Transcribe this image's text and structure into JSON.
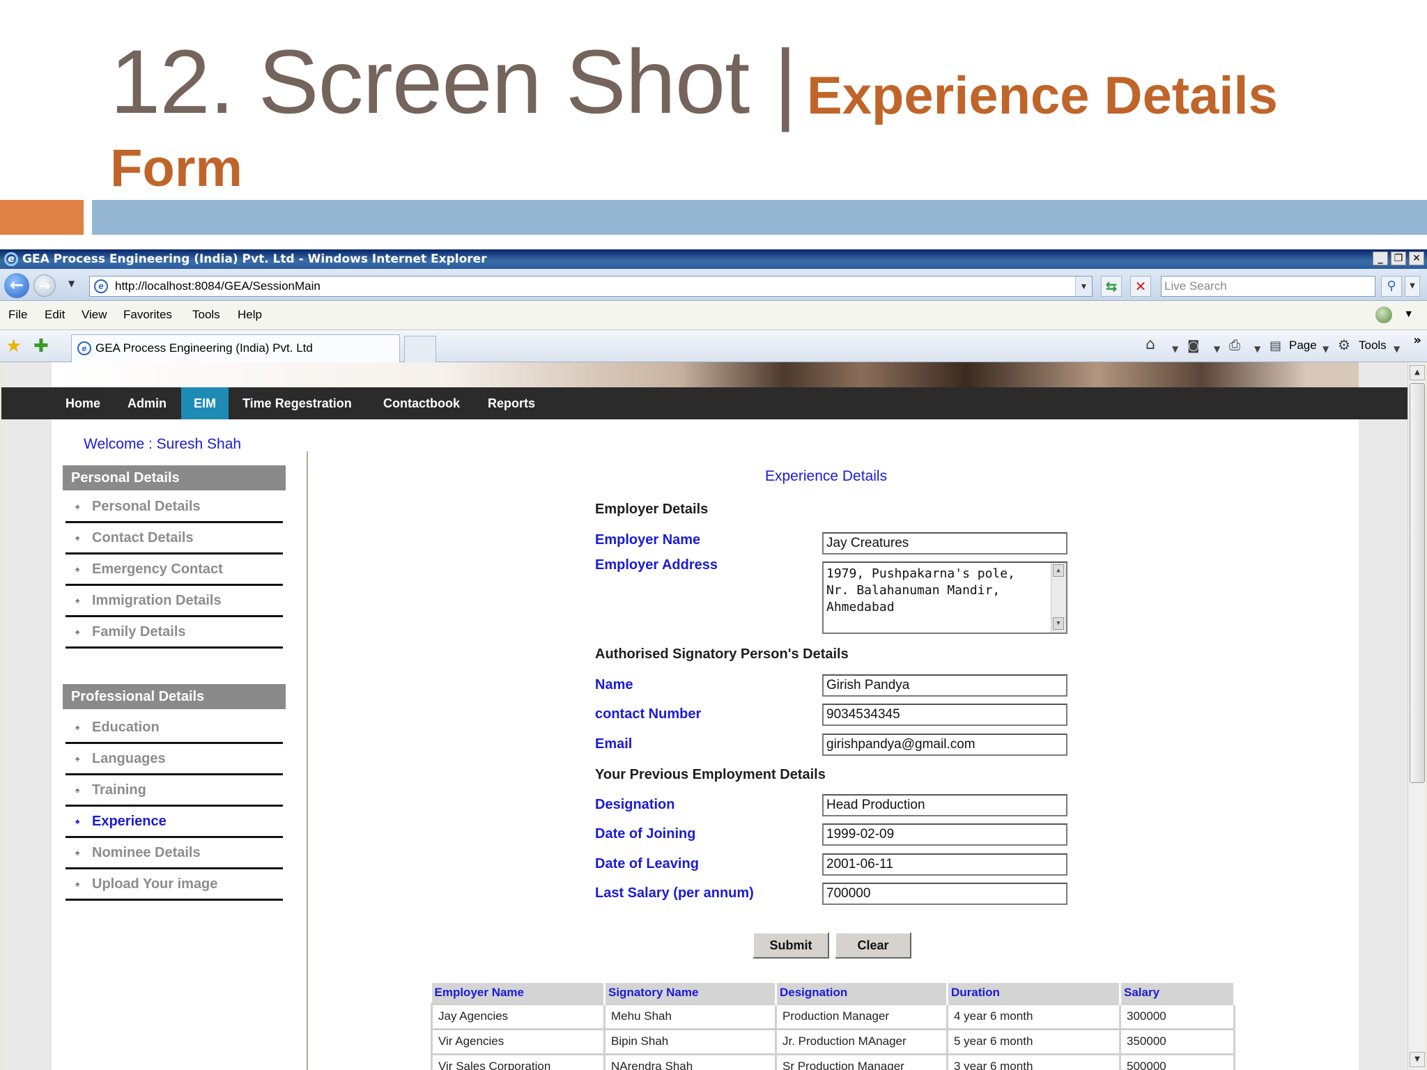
{
  "slide": {
    "title_main": "12. Screen Shot |",
    "title_sub_line1": "Experience Details",
    "title_sub_line2": "Form"
  },
  "browser": {
    "window_title": "GEA Process Engineering (India) Pvt. Ltd - Windows Internet Explorer",
    "url": "http://localhost:8084/GEA/SessionMain",
    "search_placeholder": "Live Search",
    "menu": [
      "File",
      "Edit",
      "View",
      "Favorites",
      "Tools",
      "Help"
    ],
    "tab_title": "GEA Process Engineering (India) Pvt. Ltd",
    "cmd_page": "Page",
    "cmd_tools": "Tools"
  },
  "nav": {
    "items": [
      "Home",
      "Admin",
      "EIM",
      "Time Regestration",
      "Contactbook",
      "Reports"
    ],
    "active": "EIM"
  },
  "welcome": "Welcome : Suresh Shah",
  "sidebar": {
    "personal_heading": "Personal Details",
    "personal_items": [
      "Personal Details",
      "Contact Details",
      "Emergency Contact",
      "Immigration Details",
      "Family Details"
    ],
    "professional_heading": "Professional Details",
    "professional_items": [
      "Education",
      "Languages",
      "Training",
      "Experience",
      "Nominee Details",
      "Upload Your image"
    ],
    "current": "Experience"
  },
  "form": {
    "title": "Experience Details",
    "employer_heading": "Employer Details",
    "employer_name_label": "Employer Name",
    "employer_name": "Jay Creatures",
    "employer_address_label": "Employer Address",
    "employer_address": "1979, Pushpakarna's pole,\nNr. Balahanuman Mandir,\nAhmedabad",
    "signatory_heading": "Authorised Signatory Person's Details",
    "name_label": "Name",
    "name": "Girish Pandya",
    "contact_label": "contact Number",
    "contact": "9034534345",
    "email_label": "Email",
    "email": "girishpandya@gmail.com",
    "previous_heading": "Your Previous Employment Details",
    "designation_label": "Designation",
    "designation": "Head Production",
    "joining_label": "Date of Joining",
    "joining": "1999-02-09",
    "leaving_label": "Date of Leaving",
    "leaving": "2001-06-11",
    "salary_label": "Last Salary (per annum)",
    "salary": "700000",
    "submit_label": "Submit",
    "clear_label": "Clear"
  },
  "table": {
    "headers": [
      "Employer Name",
      "Signatory Name",
      "Designation",
      "Duration",
      "Salary"
    ],
    "rows": [
      [
        "Jay Agencies",
        "Mehu Shah",
        "Production Manager",
        "4 year 6 month",
        "300000"
      ],
      [
        "Vir Agencies",
        "Bipin Shah",
        "Jr. Production MAnager",
        "5 year 6 month",
        "350000"
      ],
      [
        "Vir Sales Corporation",
        "NArendra Shah",
        "Sr Production Manager",
        "3 year 6 month",
        "500000"
      ]
    ]
  },
  "colors": {
    "title_gray": "#75645c",
    "title_orange": "#c0652a",
    "accent_orange": "#df8144",
    "accent_blue": "#94b6d2",
    "link_blue": "#1a1ad8",
    "nav_active": "#1e8bb5"
  }
}
